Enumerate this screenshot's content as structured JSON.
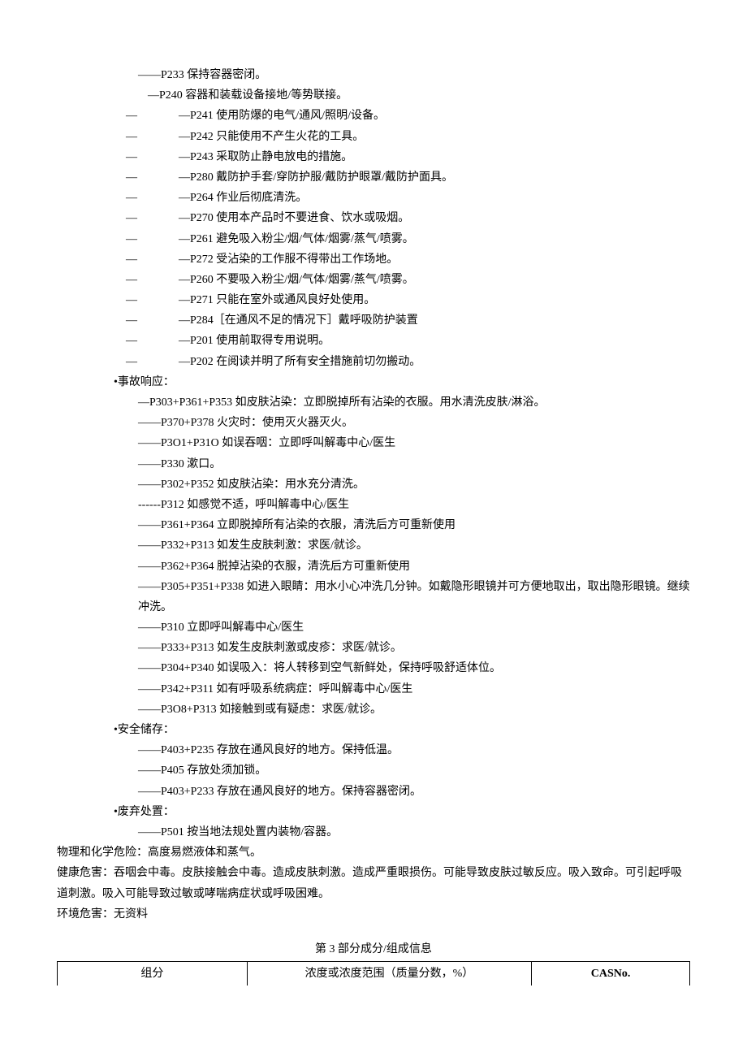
{
  "prevention_simple": [
    "——P233 保持容器密闭。",
    "—P240 容器和装载设备接地/等势联接。"
  ],
  "prevention_dash": [
    "—P241 使用防爆的电气/通风/照明/设备。",
    "—P242 只能使用不产生火花的工具。",
    "—P243 采取防止静电放电的措施。",
    "—P280 戴防护手套/穿防护服/戴防护眼罩/戴防护面具。",
    "—P264 作业后彻底清洗。",
    "—P270 使用本产品时不要进食、饮水或吸烟。",
    "—P261 避免吸入粉尘/烟/气体/烟雾/蒸气/喷雾。",
    "—P272 受沾染的工作服不得带出工作场地。",
    "—P260 不要吸入粉尘/烟/气体/烟雾/蒸气/喷雾。",
    "—P271 只能在室外或通风良好处使用。",
    "—P284［在通风不足的情况下］戴呼吸防护装置",
    "—P201 使用前取得专用说明。",
    "—P202 在阅读并明了所有安全措施前切勿搬动。"
  ],
  "accident_header": "•事故响应：",
  "accident_items": [
    "—P303+P361+P353 如皮肤沾染：立即脱掉所有沾染的衣服。用水清洗皮肤/淋浴。",
    "——P370+P378 火灾时：使用灭火器灭火。",
    "——P3O1+P31O 如误吞咽：立即呼叫解毒中心/医生",
    "——P330 漱口。",
    "——P302+P352 如皮肤沾染：用水充分清洗。",
    "------P312 如感觉不适，呼叫解毒中心/医生",
    "——P361+P364 立即脱掉所有沾染的衣服，清洗后方可重新使用",
    "——P332+P313 如发生皮肤刺激：求医/就诊。",
    "——P362+P364 脱掉沾染的衣服，清洗后方可重新使用",
    "——P305+P351+P338 如进入眼睛：用水小心冲洗几分钟。如戴隐形眼镜并可方便地取出，取出隐形眼镜。继续冲洗。",
    "——P310 立即呼叫解毒中心/医生",
    "——P333+P313 如发生皮肤刺激或皮疹：求医/就诊。",
    "——P304+P340 如误吸入：将人转移到空气新鲜处，保持呼吸舒适体位。",
    "——P342+P311 如有呼吸系统病症：呼叫解毒中心/医生",
    "——P3O8+P313 如接触到或有疑虑：求医/就诊。"
  ],
  "storage_header": "•安全储存：",
  "storage_items": [
    "——P403+P235 存放在通风良好的地方。保持低温。",
    "——P405 存放处须加锁。",
    "——P403+P233 存放在通风良好的地方。保持容器密闭。"
  ],
  "disposal_header": "•废弃处置：",
  "disposal_items": [
    "——P501 按当地法规处置内装物/容器。"
  ],
  "footer_lines": [
    "物理和化学危险：高度易燃液体和蒸气。",
    "健康危害：吞咽会中毒。皮肤接触会中毒。造成皮肤刺激。造成严重眼损伤。可能导致皮肤过敏反应。吸入致命。可引起呼吸道刺激。吸入可能导致过敏或哮喘病症状或呼吸困难。",
    "环境危害：无资料"
  ],
  "section3_title": "第 3 部分成分/组成信息",
  "table_headers": {
    "col1": "组分",
    "col2": "浓度或浓度范围（质量分数，%）",
    "col3": "CASNo."
  }
}
